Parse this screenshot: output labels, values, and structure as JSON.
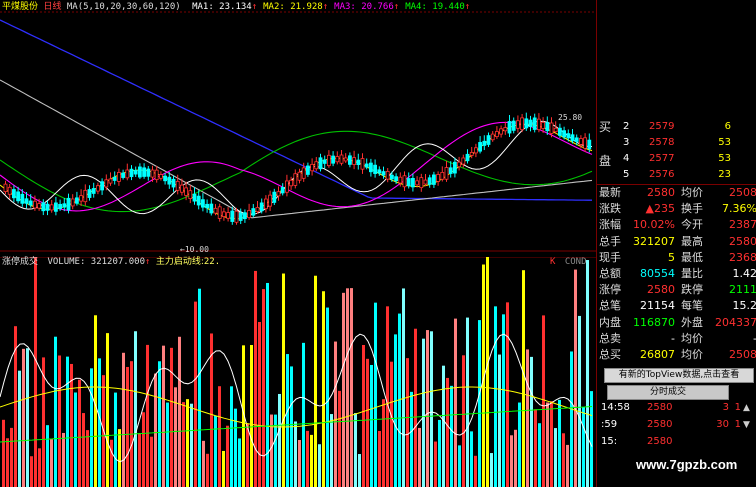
{
  "header": {
    "stock_name": "平煤股份",
    "period": "日线",
    "ma_def": "MA(5,10,20,30,60,120)",
    "ma_values": [
      {
        "label": "MA1:",
        "value": "23.134",
        "arrow": "↑",
        "color": "#ffffff"
      },
      {
        "label": "MA2:",
        "value": "21.928",
        "arrow": "↑",
        "color": "#ffff00"
      },
      {
        "label": "MA3:",
        "value": "20.766",
        "arrow": "↑",
        "color": "#ff00ff"
      },
      {
        "label": "MA4:",
        "value": "19.440",
        "arrow": "↑",
        "color": "#00ff00"
      }
    ]
  },
  "price_chart": {
    "high_label": "25.80",
    "low_label": "10.00"
  },
  "volume_header": {
    "title": "涨停成交",
    "volume_label": "VOLUME:",
    "volume_value": "321207.000",
    "arrow": "↑",
    "main_line_label": "主力启动线:",
    "main_line_value": "22.",
    "right_tags": [
      "K",
      "COND"
    ]
  },
  "order_book": {
    "buy_label_1": "买",
    "buy_label_2": "盘",
    "rows": [
      {
        "level": "2",
        "price": "2579",
        "volume": "6"
      },
      {
        "level": "3",
        "price": "2578",
        "volume": "53"
      },
      {
        "level": "4",
        "price": "2577",
        "volume": "53"
      },
      {
        "level": "5",
        "price": "2576",
        "volume": "23"
      }
    ]
  },
  "quote": [
    {
      "l1": "最新",
      "v1": "2580",
      "c1": "#ff3030",
      "l2": "均价",
      "v2": "2508",
      "c2": "#ff3030"
    },
    {
      "l1": "涨跌",
      "v1": "▲235",
      "c1": "#ff3030",
      "l2": "换手",
      "v2": "7.36%",
      "c2": "#ffff00"
    },
    {
      "l1": "涨幅",
      "v1": "10.02%",
      "c1": "#ff3030",
      "l2": "今开",
      "v2": "2387",
      "c2": "#ff3030"
    },
    {
      "l1": "总手",
      "v1": "321207",
      "c1": "#ffff00",
      "l2": "最高",
      "v2": "2580",
      "c2": "#ff3030"
    },
    {
      "l1": "现手",
      "v1": "5",
      "c1": "#ffff00",
      "l2": "最低",
      "v2": "2368",
      "c2": "#ff3030"
    },
    {
      "l1": "总额",
      "v1": "80554",
      "c1": "#00ffff",
      "l2": "量比",
      "v2": "1.42",
      "c2": "#ffffff"
    },
    {
      "l1": "涨停",
      "v1": "2580",
      "c1": "#ff3030",
      "l2": "跌停",
      "v2": "2111",
      "c2": "#00ff00"
    },
    {
      "l1": "总笔",
      "v1": "21154",
      "c1": "#ffffff",
      "l2": "每笔",
      "v2": "15.2",
      "c2": "#ffffff"
    },
    {
      "l1": "内盘",
      "v1": "116870",
      "c1": "#00ff00",
      "l2": "外盘",
      "v2": "204337",
      "c2": "#ff3030"
    },
    {
      "l1": "总卖",
      "v1": "-",
      "c1": "#ffffff",
      "l2": "均价",
      "v2": "-",
      "c2": "#ffffff"
    },
    {
      "l1": "总买",
      "v1": "26807",
      "c1": "#ffff00",
      "l2": "均价",
      "v2": "2508",
      "c2": "#ff3030"
    }
  ],
  "topview_button": "有新的TopView数据,点击查看",
  "ticks_tab": "分时成交",
  "ticks": [
    {
      "time": "14:58",
      "price": "2580",
      "vol": "3",
      "dir": "1"
    },
    {
      "time": ":59",
      "price": "2580",
      "vol": "30",
      "dir": "1"
    },
    {
      "time": "15:",
      "price": "2580",
      "vol": "",
      "dir": ""
    }
  ],
  "watermark": "www.7gpzb.com"
}
